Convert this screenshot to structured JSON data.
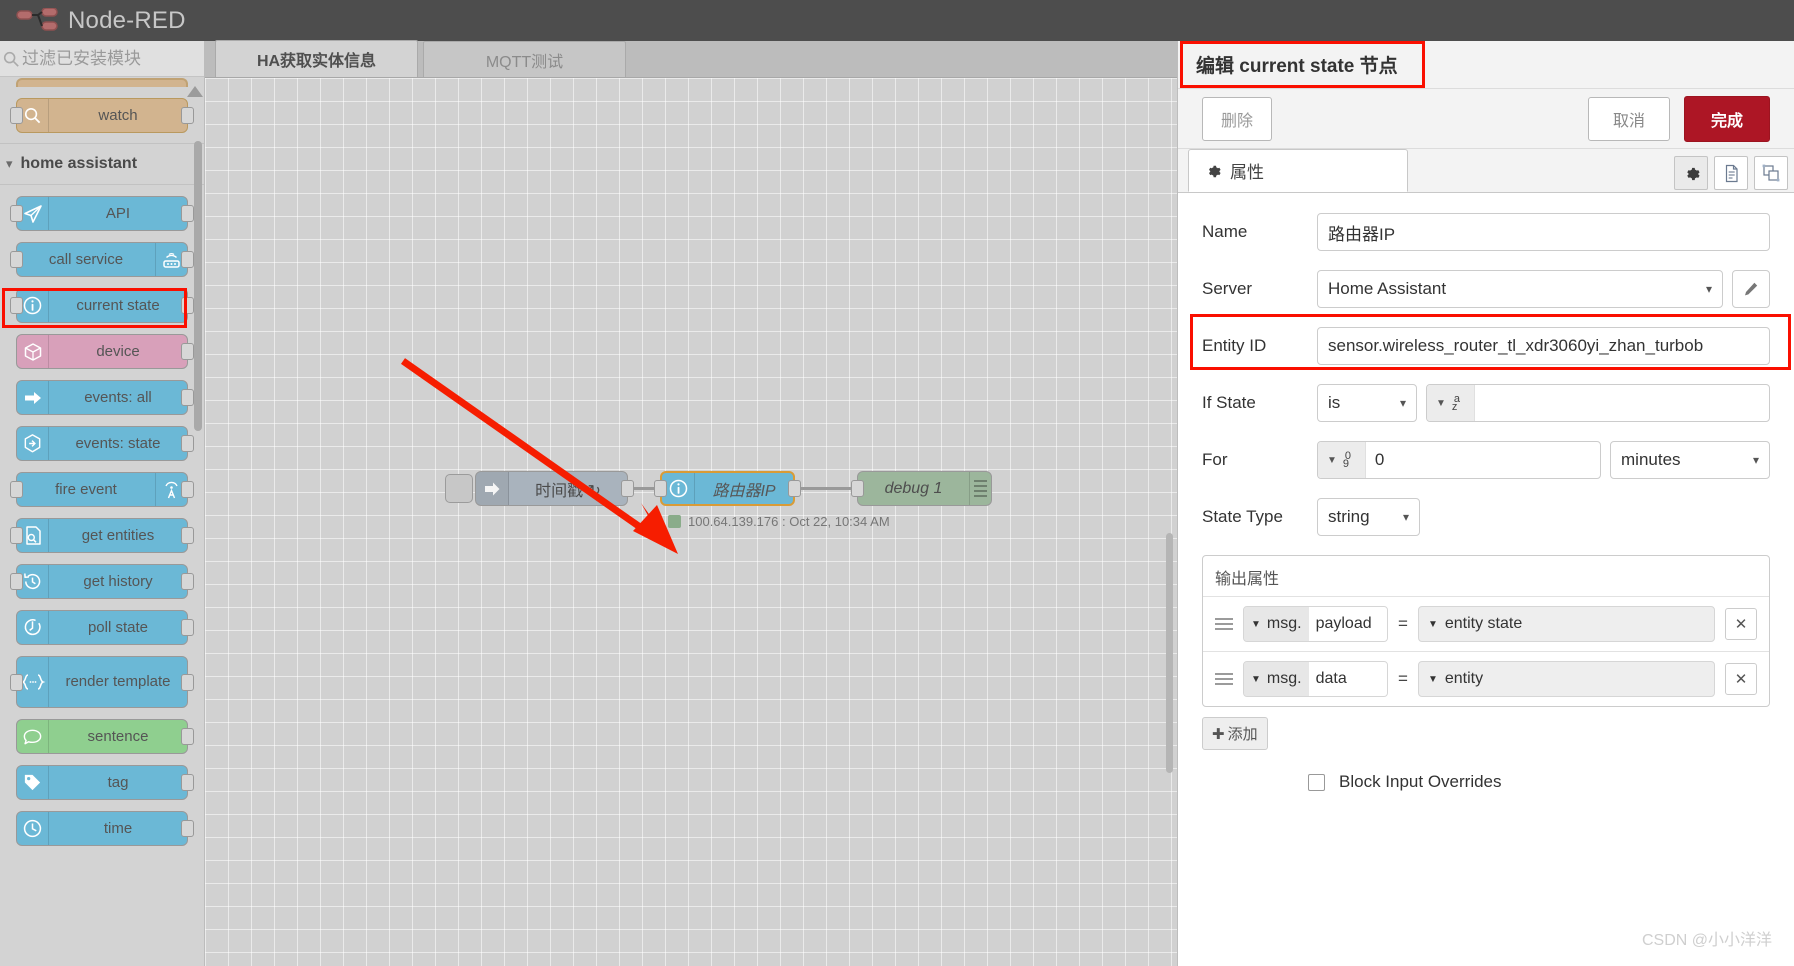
{
  "header": {
    "app_title": "Node-RED",
    "logo_icon": "node-red-logo-icon"
  },
  "palette": {
    "search_placeholder": "过滤已安装模块",
    "search_value": "",
    "search_icon": "search-icon",
    "category": {
      "label": "home assistant",
      "chevron_icon": "chevron-down-icon"
    },
    "top_node": {
      "label": "watch",
      "icon": "magnifier-icon"
    },
    "items": [
      {
        "label": "API",
        "icon": "paper-plane-icon",
        "color": "blue",
        "icon_side": "left"
      },
      {
        "label": "call service",
        "icon": "router-icon",
        "color": "blue",
        "icon_side": "right"
      },
      {
        "label": "current state",
        "icon": "info-circle-icon",
        "color": "blue",
        "icon_side": "left"
      },
      {
        "label": "device",
        "icon": "cube-icon",
        "color": "pink",
        "icon_side": "left"
      },
      {
        "label": "events: all",
        "icon": "arrow-right-icon",
        "color": "blue",
        "icon_side": "left"
      },
      {
        "label": "events: state",
        "icon": "hexagon-arrow-icon",
        "color": "blue",
        "icon_side": "left"
      },
      {
        "label": "fire event",
        "icon": "broadcast-icon",
        "color": "blue",
        "icon_side": "right"
      },
      {
        "label": "get entities",
        "icon": "file-search-icon",
        "color": "blue",
        "icon_side": "left"
      },
      {
        "label": "get history",
        "icon": "clock-rewind-icon",
        "color": "blue",
        "icon_side": "left"
      },
      {
        "label": "poll state",
        "icon": "stopwatch-icon",
        "color": "blue",
        "icon_side": "left"
      },
      {
        "label": "render template",
        "icon": "curly-braces-icon",
        "color": "blue",
        "icon_side": "left"
      },
      {
        "label": "sentence",
        "icon": "speech-bubble-icon",
        "color": "green",
        "icon_side": "left"
      },
      {
        "label": "tag",
        "icon": "tag-icon",
        "color": "blue",
        "icon_side": "left"
      },
      {
        "label": "time",
        "icon": "clock-icon",
        "color": "blue",
        "icon_side": "left"
      }
    ]
  },
  "flow_tabs": [
    {
      "label": "HA获取实体信息",
      "active": true
    },
    {
      "label": "MQTT测试",
      "active": false
    }
  ],
  "canvas": {
    "nodes": [
      {
        "name": "时间戳 ↻",
        "type": "inject",
        "icon": "inject-arrow-icon"
      },
      {
        "name": "路由器IP",
        "type": "current-state",
        "icon": "info-circle-icon"
      },
      {
        "name": "debug 1",
        "type": "debug",
        "icon": "debug-lines-icon"
      }
    ],
    "node_status": "100.64.139.176 : Oct 22, 10:34 AM",
    "annotation_arrow": "red-arrow-pointer"
  },
  "editor": {
    "title_prefix": "编辑 ",
    "title_node": "current state",
    "title_suffix": " 节点",
    "delete_label": "删除",
    "cancel_label": "取消",
    "done_label": "完成",
    "tab_label": "属性",
    "tab_icon": "gear-icon",
    "tab_buttons": [
      {
        "icon": "gear-icon",
        "active": true
      },
      {
        "icon": "description-icon",
        "active": false
      },
      {
        "icon": "appearance-icon",
        "active": false
      }
    ],
    "fields": {
      "name_label": "Name",
      "name_value": "路由器IP",
      "server_label": "Server",
      "server_value": "Home Assistant",
      "server_edit_icon": "pencil-icon",
      "entity_label": "Entity ID",
      "entity_value": "sensor.wireless_router_tl_xdr3060yi_zhan_turbob",
      "ifstate_label": "If State",
      "ifstate_op": "is",
      "ifstate_type_icon": "az-string-icon",
      "ifstate_value": "",
      "for_label": "For",
      "for_type_icon": "09-number-icon",
      "for_value": "0",
      "for_units": "minutes",
      "statetype_label": "State Type",
      "statetype_value": "string"
    },
    "outputs": {
      "legend": "输出属性",
      "rows": [
        {
          "scope": "msg.",
          "property": "payload",
          "equals": "=",
          "value": "entity state",
          "remove_label": "✕"
        },
        {
          "scope": "msg.",
          "property": "data",
          "equals": "=",
          "value": "entity",
          "remove_label": "✕"
        }
      ],
      "add_label": "添加"
    },
    "block_input_label": "Block Input Overrides",
    "block_input_checked": false
  },
  "watermark": "CSDN @小小洋洋",
  "colors": {
    "accent_red": "#ad1625",
    "highlight_red": "#fa0f00",
    "node_blue": "#6bb8d6",
    "node_pink": "#d8a0ba",
    "node_green": "#8fcf8f",
    "header_gray": "#4d4d4d"
  }
}
